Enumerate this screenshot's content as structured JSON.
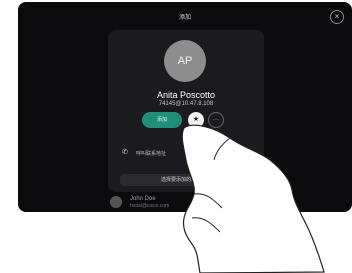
{
  "header": {
    "title": "添加",
    "close_glyph": "×"
  },
  "contact": {
    "initials": "AP",
    "name": "Anita Poscotto",
    "number": "74145@10.47.8.108"
  },
  "actions": {
    "call_label": "添加",
    "favorite_glyph": "★",
    "more_glyph": "···"
  },
  "detail_row": {
    "icon": "phone-icon",
    "label": "呼叫联系地址"
  },
  "action_strip_label": "选择要添加的通话地址",
  "background_contact": {
    "name": "John Doe",
    "email": "hvaal@cisco.com"
  },
  "colors": {
    "accent": "#1f8f7b",
    "screen": "#0b0b0d",
    "card": "#1b1b1f"
  }
}
